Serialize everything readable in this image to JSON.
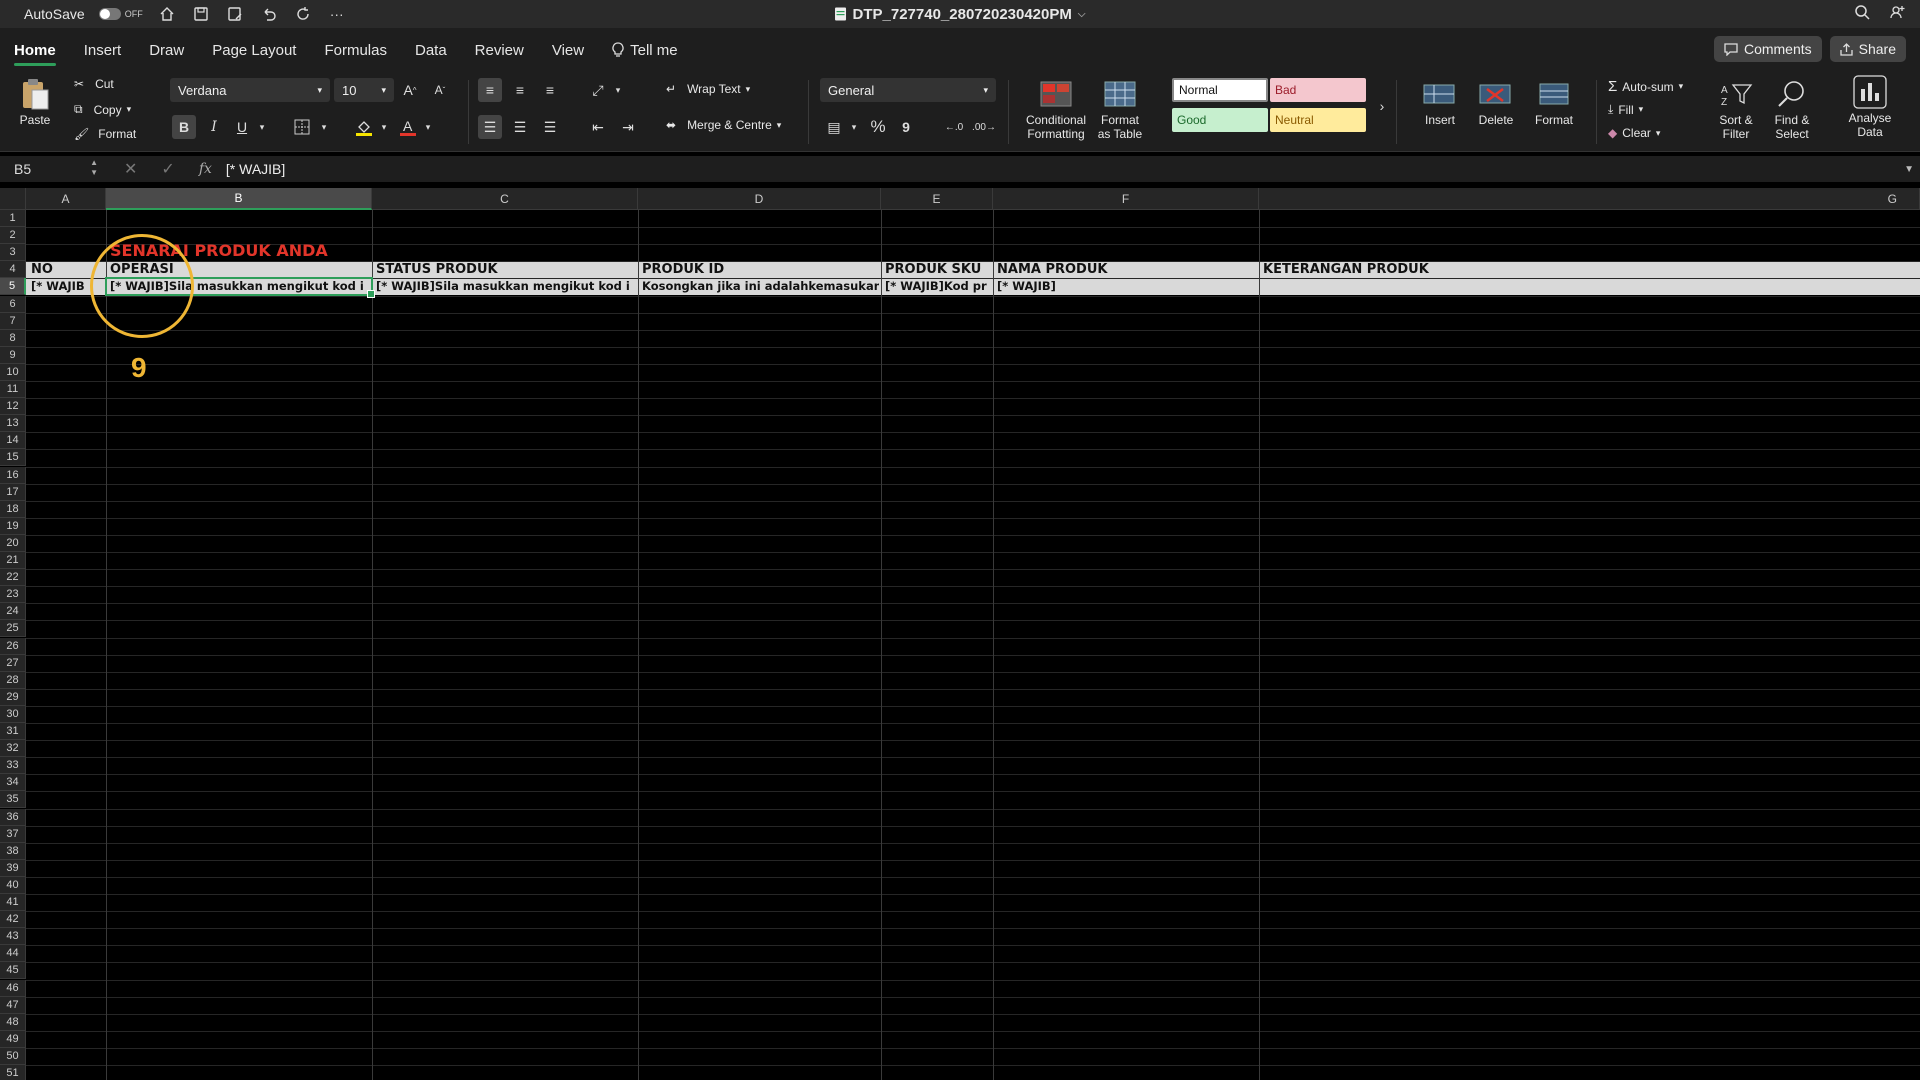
{
  "titlebar": {
    "autosave_label": "AutoSave",
    "autosave_state": "OFF",
    "doc_title": "DTP_727740_280720230420PM"
  },
  "tabs": [
    {
      "label": "Home"
    },
    {
      "label": "Insert"
    },
    {
      "label": "Draw"
    },
    {
      "label": "Page Layout"
    },
    {
      "label": "Formulas"
    },
    {
      "label": "Data"
    },
    {
      "label": "Review"
    },
    {
      "label": "View"
    }
  ],
  "tell_me": "Tell me",
  "comments_label": "Comments",
  "share_label": "Share",
  "ribbon": {
    "paste": "Paste",
    "cut": "Cut",
    "copy": "Copy",
    "format_painter": "Format",
    "font_name": "Verdana",
    "font_size": "10",
    "bold": "B",
    "italic": "I",
    "underline": "U",
    "wrap_text": "Wrap Text",
    "merge_centre": "Merge & Centre",
    "number_format": "General",
    "percent": "%",
    "comma": "9",
    "conditional_formatting": [
      "Conditional",
      "Formatting"
    ],
    "format_as_table": [
      "Format",
      "as Table"
    ],
    "styles": {
      "normal": "Normal",
      "bad": "Bad",
      "good": "Good",
      "neutral": "Neutral"
    },
    "insert": "Insert",
    "delete": "Delete",
    "format": "Format",
    "autosum": "Auto-sum",
    "fill": "Fill",
    "clear": "Clear",
    "sort_filter": [
      "Sort &",
      "Filter"
    ],
    "find_select": [
      "Find &",
      "Select"
    ],
    "analyse_data": [
      "Analyse",
      "Data"
    ]
  },
  "formula_bar": {
    "name_box": "B5",
    "fx": "fx",
    "value": "[* WAJIB]"
  },
  "columns": [
    "A",
    "B",
    "C",
    "D",
    "E",
    "F",
    "G"
  ],
  "sheet": {
    "title": "SENARAI PRODUK ANDA",
    "headers": [
      "NO",
      "OPERASI",
      "STATUS PRODUK",
      "PRODUK ID",
      "PRODUK SKU",
      "NAMA PRODUK",
      "KETERANGAN PRODUK"
    ],
    "row5": [
      "[* WAJIB",
      "[* WAJIB]Sila masukkan mengikut kod i",
      "[* WAJIB]Sila masukkan mengikut kod i",
      "Kosongkan jika ini adalahkemasukan",
      "[* WAJIB]Kod pr",
      "[* WAJIB]",
      ""
    ]
  },
  "annotation": {
    "step_number": "9",
    "color": "#efb634"
  },
  "colors": {
    "accent": "#2e9e5a",
    "title_red": "#e2352a"
  }
}
